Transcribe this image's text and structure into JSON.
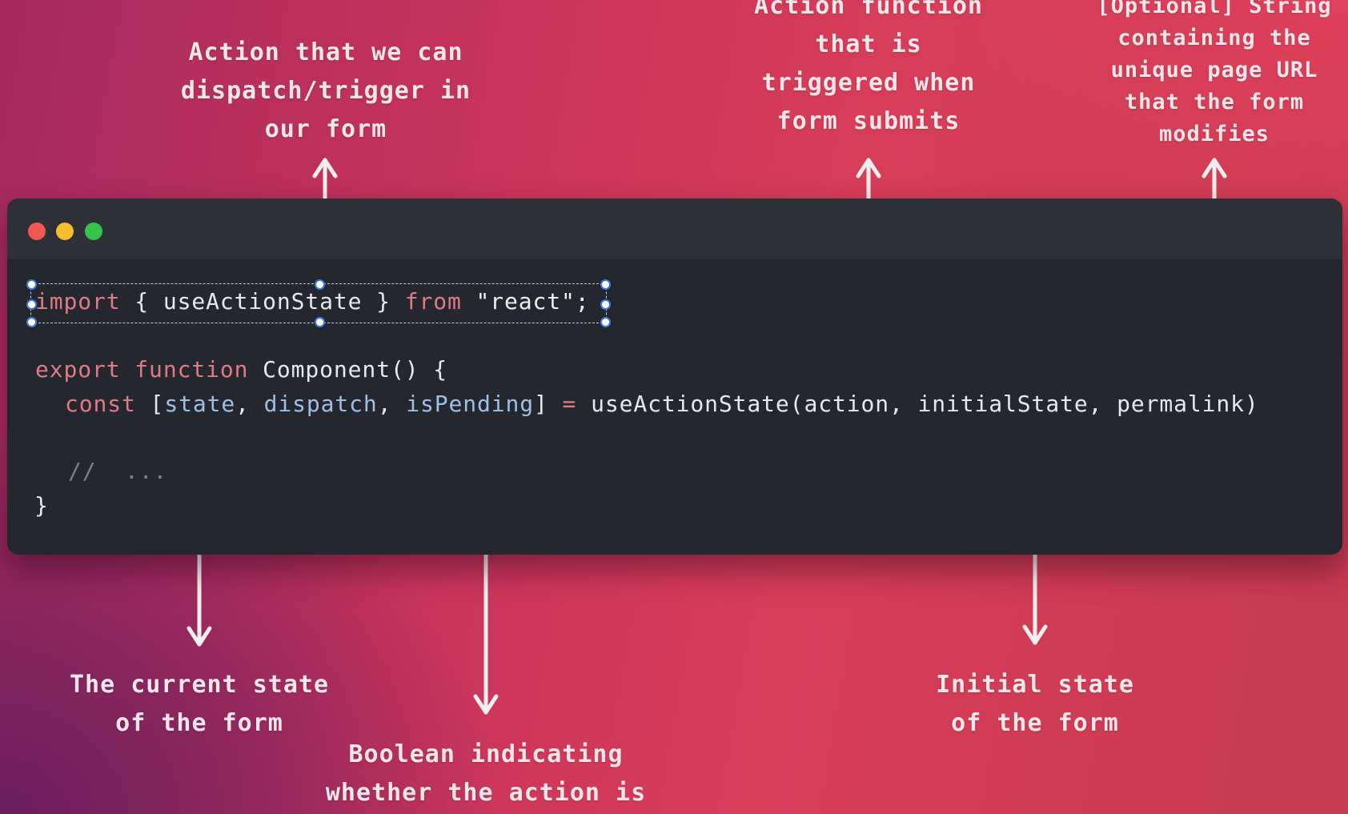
{
  "annotations": {
    "dispatch": [
      "Action that we can",
      "dispatch/trigger in",
      "our form"
    ],
    "action": [
      "Action function",
      "that is",
      "triggered when",
      "form submits"
    ],
    "permalink": [
      "[Optional] String",
      "containing the",
      "unique page URL",
      "that the form",
      "modifies"
    ],
    "state": [
      "The current state",
      "of the form"
    ],
    "initial": [
      "Initial state",
      "of the form"
    ],
    "pending": [
      "Boolean indicating",
      "whether the action is"
    ]
  },
  "code": {
    "import_kw": "import",
    "import_body": " { useActionState } ",
    "from_kw": "from",
    "import_str": " \"react\";",
    "export_kw": "export",
    "function_kw": " function",
    "component_sig": " Component() {",
    "const_kw": "const",
    "bracket_open": " [",
    "var_state": "state",
    "comma1": ", ",
    "var_dispatch": "dispatch",
    "comma2": ", ",
    "var_pending": "isPending",
    "bracket_close": "]",
    "equals": " = ",
    "call": "useActionState(action, initialState, permalink)",
    "comment": "//  ...",
    "close_brace": "}"
  },
  "colors": {
    "keyword": "#e07a86",
    "variable": "#9dc0e6",
    "editor_bg": "#25272e",
    "arrow": "#f5eef1"
  }
}
